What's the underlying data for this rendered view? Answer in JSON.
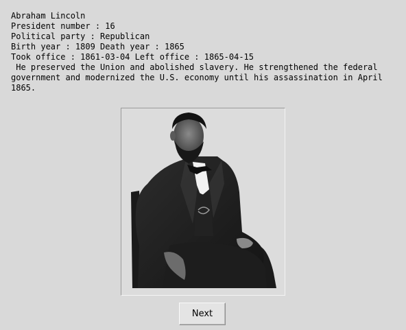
{
  "president": {
    "name": "Abraham Lincoln",
    "number_line": "President number : 16",
    "party_line": "Political party : Republican",
    "years_line": "Birth year : 1809 Death year : 1865",
    "office_line": "Took office : 1861-03-04 Left office : 1865-04-15",
    "description": " He preserved the Union and abolished slavery. He strengthened the federal government and modernized the U.S. economy until his assassination in April 1865."
  },
  "portrait": {
    "icon": "portrait-photo"
  },
  "navigation": {
    "next_label": "Next"
  }
}
